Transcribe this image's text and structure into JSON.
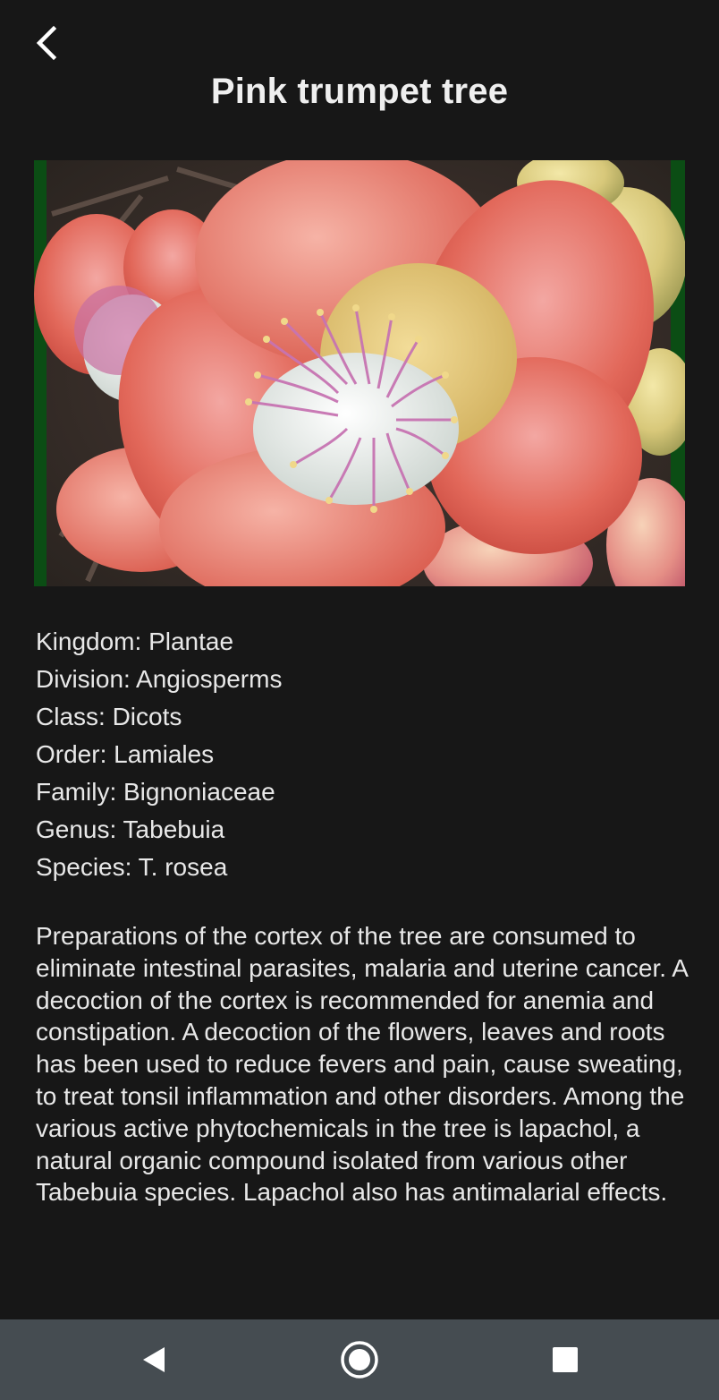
{
  "header": {
    "back_icon": "chevron-left-icon",
    "title": "Pink trumpet tree"
  },
  "image": {
    "subject": "flower-photo",
    "frame_color": "#0b4d14"
  },
  "taxonomy": {
    "kingdom": "Kingdom: Plantae",
    "division": "Division: Angiosperms",
    "class": "Class: Dicots",
    "order": "Order: Lamiales",
    "family": "Family: Bignoniaceae",
    "genus": "Genus: Tabebuia",
    "species": "Species: T. rosea"
  },
  "description": "Preparations of the cortex of the tree are consumed to eliminate intestinal parasites, malaria and uterine cancer. A decoction of the cortex is recommended for anemia and constipation. A decoction of the flowers, leaves and roots has been used to reduce fevers and pain, cause sweating, to treat tonsil inflammation and other disorders. Among the various active phytochemicals in the tree is lapachol, a natural organic compound isolated from various other Tabebuia species. Lapachol also has antimalarial effects.",
  "navbar": {
    "back_icon": "triangle-back-icon",
    "home_icon": "circle-home-icon",
    "recents_icon": "square-recents-icon",
    "background": "#454c51"
  }
}
